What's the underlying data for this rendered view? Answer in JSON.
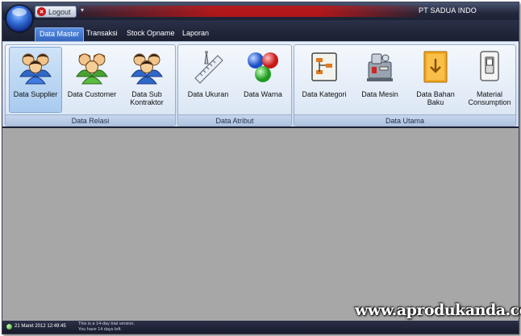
{
  "titlebar": {
    "logout_label": "Logout",
    "app_title": "PT SADUA INDO",
    "qat_arrow": "▾"
  },
  "tabs": [
    {
      "label": "Data Master",
      "active": true
    },
    {
      "label": "Transaksi",
      "active": false
    },
    {
      "label": "Stock Opname",
      "active": false
    },
    {
      "label": "Laporan",
      "active": false
    }
  ],
  "ribbon": {
    "groups": [
      {
        "caption": "Data Relasi",
        "buttons": [
          {
            "label": "Data Supplier",
            "icon": "users-group-icon",
            "selected": true
          },
          {
            "label": "Data Customer",
            "icon": "users-group-icon",
            "selected": false
          },
          {
            "label": "Data Sub Kontraktor",
            "icon": "users-group-icon",
            "selected": false
          }
        ]
      },
      {
        "caption": "Data Atribut",
        "buttons": [
          {
            "label": "Data Ukuran",
            "icon": "measure-icon",
            "selected": false
          },
          {
            "label": "Data Warna",
            "icon": "color-balls-icon",
            "selected": false
          }
        ]
      },
      {
        "caption": "Data Utama",
        "buttons": [
          {
            "label": "Data Kategori",
            "icon": "category-icon",
            "selected": false
          },
          {
            "label": "Data Mesin",
            "icon": "machine-icon",
            "selected": false
          },
          {
            "label": "Data Bahan Baku",
            "icon": "box-icon",
            "selected": false
          },
          {
            "label": "Material Consumption",
            "icon": "switch-icon",
            "selected": false
          }
        ]
      }
    ]
  },
  "statusbar": {
    "datetime": "21 Maret 2012 12:49:45",
    "trial_line1": "This is a 14-day trial version.",
    "trial_line2": "You have 14 days left."
  },
  "watermark": "www.aprodukanda.com",
  "colors": {
    "titlebar": "#23283c",
    "ribbon": "#dce6f4",
    "workarea": "#a7a7a7",
    "active_tab": "#3f74cc"
  }
}
